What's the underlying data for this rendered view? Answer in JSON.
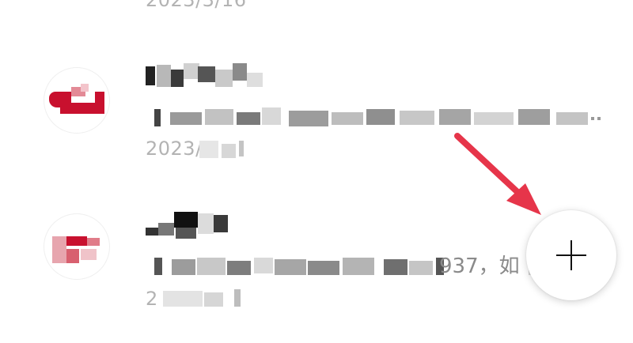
{
  "list": {
    "top_date": "2023/3/16",
    "items": [
      {
        "title": "",
        "preview": "",
        "date": "2023/"
      },
      {
        "title": "",
        "preview_visible": "937，如",
        "date": "2"
      }
    ]
  },
  "fab": {
    "icon": "plus-icon",
    "label": ""
  },
  "annotation": {
    "arrow_color": "#e6354a"
  },
  "colors": {
    "avatar_red": "#c8102e",
    "text_gray": "#b3b3b3"
  }
}
